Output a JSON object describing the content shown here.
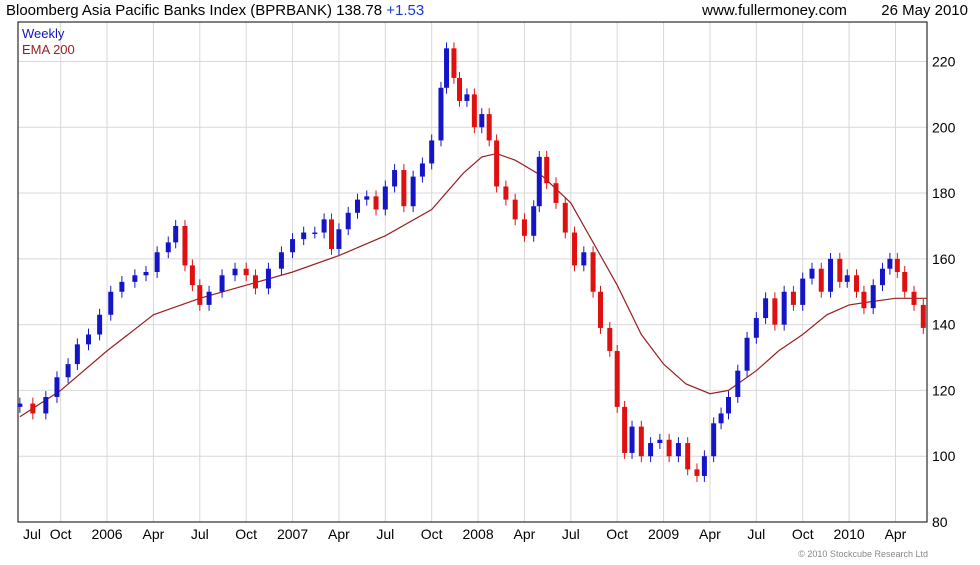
{
  "header": {
    "title": "Bloomberg Asia Pacific Banks Index (BPRBANK)",
    "last": "138.78",
    "change": "+1.53",
    "site": "www.fullermoney.com",
    "date": "26 May 2010"
  },
  "copyright": "© 2010 Stockcube Research Ltd",
  "colors": {
    "up": "#1515c8",
    "down": "#e01010",
    "ema": "#9a2020",
    "grid": "#d8d8d8",
    "legend_weekly": "#1515c8",
    "legend_ema": "#9a2020"
  },
  "chart_data": {
    "type": "candlestick",
    "title": "Bloomberg Asia Pacific Banks Index (BPRBANK)",
    "legend": [
      "Weekly",
      "EMA 200"
    ],
    "legend_position": "top-left",
    "y_axis_position": "right",
    "ylim": [
      80,
      232
    ],
    "yticks": [
      80,
      100,
      120,
      140,
      160,
      180,
      200,
      220
    ],
    "xlim": [
      2005.52,
      2010.42
    ],
    "xticks": [
      {
        "x": 2005.5,
        "label": "Jul"
      },
      {
        "x": 2005.75,
        "label": "Oct"
      },
      {
        "x": 2006.0,
        "label": "2006"
      },
      {
        "x": 2006.25,
        "label": "Apr"
      },
      {
        "x": 2006.5,
        "label": "Jul"
      },
      {
        "x": 2006.75,
        "label": "Oct"
      },
      {
        "x": 2007.0,
        "label": "2007"
      },
      {
        "x": 2007.25,
        "label": "Apr"
      },
      {
        "x": 2007.5,
        "label": "Jul"
      },
      {
        "x": 2007.75,
        "label": "Oct"
      },
      {
        "x": 2008.0,
        "label": "2008"
      },
      {
        "x": 2008.25,
        "label": "Apr"
      },
      {
        "x": 2008.5,
        "label": "Jul"
      },
      {
        "x": 2008.75,
        "label": "Oct"
      },
      {
        "x": 2009.0,
        "label": "2009"
      },
      {
        "x": 2009.25,
        "label": "Apr"
      },
      {
        "x": 2009.5,
        "label": "Jul"
      },
      {
        "x": 2009.75,
        "label": "Oct"
      },
      {
        "x": 2010.0,
        "label": "2010"
      },
      {
        "x": 2010.25,
        "label": "Apr"
      }
    ],
    "grid": true,
    "weekly_close": [
      [
        2005.53,
        116
      ],
      [
        2005.6,
        113
      ],
      [
        2005.67,
        118
      ],
      [
        2005.73,
        124
      ],
      [
        2005.79,
        128
      ],
      [
        2005.84,
        134
      ],
      [
        2005.9,
        137
      ],
      [
        2005.96,
        143
      ],
      [
        2006.02,
        150
      ],
      [
        2006.08,
        153
      ],
      [
        2006.15,
        155
      ],
      [
        2006.21,
        156
      ],
      [
        2006.27,
        162
      ],
      [
        2006.33,
        165
      ],
      [
        2006.37,
        170
      ],
      [
        2006.42,
        158
      ],
      [
        2006.46,
        152
      ],
      [
        2006.5,
        146
      ],
      [
        2006.55,
        150
      ],
      [
        2006.62,
        155
      ],
      [
        2006.69,
        157
      ],
      [
        2006.75,
        155
      ],
      [
        2006.8,
        151
      ],
      [
        2006.87,
        157
      ],
      [
        2006.94,
        162
      ],
      [
        2007.0,
        166
      ],
      [
        2007.06,
        168
      ],
      [
        2007.12,
        168
      ],
      [
        2007.17,
        172
      ],
      [
        2007.21,
        163
      ],
      [
        2007.25,
        169
      ],
      [
        2007.3,
        174
      ],
      [
        2007.35,
        178
      ],
      [
        2007.4,
        179
      ],
      [
        2007.45,
        175
      ],
      [
        2007.5,
        182
      ],
      [
        2007.55,
        187
      ],
      [
        2007.6,
        176
      ],
      [
        2007.65,
        185
      ],
      [
        2007.7,
        189
      ],
      [
        2007.75,
        196
      ],
      [
        2007.8,
        212
      ],
      [
        2007.83,
        224
      ],
      [
        2007.87,
        215
      ],
      [
        2007.9,
        208
      ],
      [
        2007.94,
        210
      ],
      [
        2007.98,
        200
      ],
      [
        2008.02,
        204
      ],
      [
        2008.06,
        196
      ],
      [
        2008.1,
        182
      ],
      [
        2008.15,
        178
      ],
      [
        2008.2,
        172
      ],
      [
        2008.25,
        167
      ],
      [
        2008.3,
        176
      ],
      [
        2008.33,
        191
      ],
      [
        2008.37,
        183
      ],
      [
        2008.42,
        177
      ],
      [
        2008.47,
        168
      ],
      [
        2008.52,
        158
      ],
      [
        2008.57,
        162
      ],
      [
        2008.62,
        150
      ],
      [
        2008.66,
        139
      ],
      [
        2008.71,
        132
      ],
      [
        2008.75,
        115
      ],
      [
        2008.79,
        101
      ],
      [
        2008.83,
        109
      ],
      [
        2008.88,
        100
      ],
      [
        2008.93,
        104
      ],
      [
        2008.98,
        105
      ],
      [
        2009.03,
        100
      ],
      [
        2009.08,
        104
      ],
      [
        2009.13,
        96
      ],
      [
        2009.18,
        94
      ],
      [
        2009.22,
        100
      ],
      [
        2009.27,
        110
      ],
      [
        2009.31,
        113
      ],
      [
        2009.35,
        118
      ],
      [
        2009.4,
        126
      ],
      [
        2009.45,
        136
      ],
      [
        2009.5,
        142
      ],
      [
        2009.55,
        148
      ],
      [
        2009.6,
        140
      ],
      [
        2009.65,
        150
      ],
      [
        2009.7,
        146
      ],
      [
        2009.75,
        154
      ],
      [
        2009.8,
        157
      ],
      [
        2009.85,
        150
      ],
      [
        2009.9,
        160
      ],
      [
        2009.95,
        153
      ],
      [
        2009.99,
        155
      ],
      [
        2010.04,
        150
      ],
      [
        2010.08,
        145
      ],
      [
        2010.13,
        152
      ],
      [
        2010.18,
        157
      ],
      [
        2010.22,
        160
      ],
      [
        2010.26,
        156
      ],
      [
        2010.3,
        150
      ],
      [
        2010.35,
        146
      ],
      [
        2010.4,
        139
      ]
    ],
    "ema_200": [
      [
        2005.53,
        112
      ],
      [
        2005.75,
        120
      ],
      [
        2006.0,
        132
      ],
      [
        2006.25,
        143
      ],
      [
        2006.5,
        148
      ],
      [
        2006.75,
        152
      ],
      [
        2007.0,
        156
      ],
      [
        2007.25,
        161
      ],
      [
        2007.5,
        167
      ],
      [
        2007.75,
        175
      ],
      [
        2007.92,
        186
      ],
      [
        2008.02,
        191
      ],
      [
        2008.1,
        192
      ],
      [
        2008.2,
        190
      ],
      [
        2008.35,
        185
      ],
      [
        2008.5,
        177
      ],
      [
        2008.62,
        165
      ],
      [
        2008.75,
        152
      ],
      [
        2008.88,
        137
      ],
      [
        2009.0,
        128
      ],
      [
        2009.12,
        122
      ],
      [
        2009.25,
        119
      ],
      [
        2009.35,
        120
      ],
      [
        2009.5,
        126
      ],
      [
        2009.62,
        132
      ],
      [
        2009.75,
        137
      ],
      [
        2009.88,
        143
      ],
      [
        2010.0,
        146
      ],
      [
        2010.12,
        147
      ],
      [
        2010.25,
        148
      ],
      [
        2010.42,
        148
      ]
    ]
  }
}
